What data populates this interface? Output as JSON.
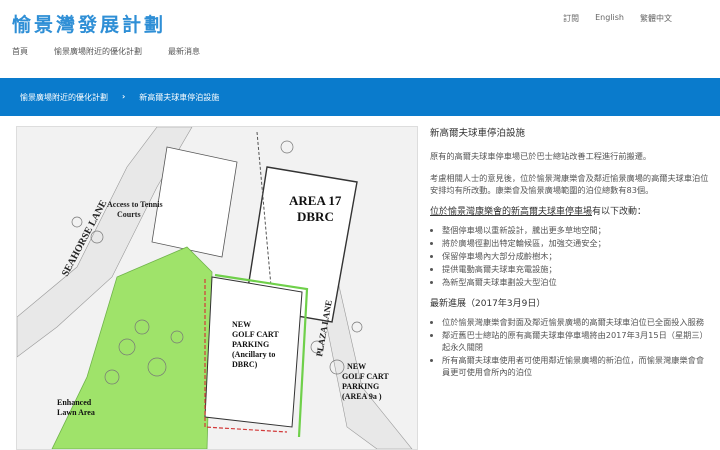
{
  "site": {
    "title": "愉景灣發展計劃"
  },
  "utility_links": [
    "訂閱",
    "English",
    "繁體中文"
  ],
  "main_nav": [
    "首頁",
    "愉景廣場附近的優化計劃",
    "最新消息"
  ],
  "breadcrumb": [
    "愉景廣場附近的優化計劃",
    "›",
    "新高爾夫球車停泊設施"
  ],
  "map": {
    "labels": {
      "seahorse": "SEAHORSE LANE",
      "tennis": "Access to Tennis Courts",
      "area17_l1": "AREA 17",
      "area17_l2": "DBRC",
      "plaza": "PLAZA LANE",
      "newgolf_a_l1": "NEW",
      "newgolf_a_l2": "GOLF CART",
      "newgolf_a_l3": "PARKING",
      "newgolf_a_l4": "(Ancillary to",
      "newgolf_a_l5": "DBRC)",
      "newgolf_b_l1": "NEW",
      "newgolf_b_l2": "GOLF CART",
      "newgolf_b_l3": "PARKING",
      "newgolf_b_l4": "(AREA 9a )",
      "lawn_l1": "Enhanced",
      "lawn_l2": "Lawn Area"
    },
    "colors": {
      "lawn": "#9fe36a",
      "building": "#ffffff",
      "outline": "#3a3a3a",
      "road": "#e6e6e6",
      "parking_red": "#d23a3a"
    }
  },
  "content": {
    "heading": "新高爾夫球車停泊設施",
    "p1": "原有的高爾夫球車停車場已於巴士總站改善工程進行前搬遷。",
    "p2": "考慮相關人士的意見後，位於愉景灣康樂會及鄰近愉景廣場的高爾夫球車泊位安排均有所改動。康樂會及愉景廣場範圍的泊位總數有83個。",
    "sub1_underlined": "位於愉景灣康樂會的新高爾夫球車停車場",
    "sub1_rest": "有以下改動：",
    "list1": [
      "整個停車場以重新設計，騰出更多草地空間；",
      "將於廣場徑劃出特定輪候區，加強交通安全；",
      "保留停車場內大部分成齡樹木；",
      "提供電動高爾夫球車充電設施；",
      "為新型高爾夫球車劃設大型泊位"
    ],
    "latest_heading": "最新進展（2017年3月9日）",
    "list2": [
      "位於愉景灣康樂會對面及鄰近愉景廣場的高爾夫球車泊位已全面投入服務",
      "鄰近舊巴士總站的原有高爾夫球車停車場將由2017年3月15日（星期三）起永久關閉",
      "所有高爾夫球車使用者可使用鄰近愉景廣場的新泊位，而愉景灣康樂會會員更可使用會所內的泊位"
    ]
  }
}
